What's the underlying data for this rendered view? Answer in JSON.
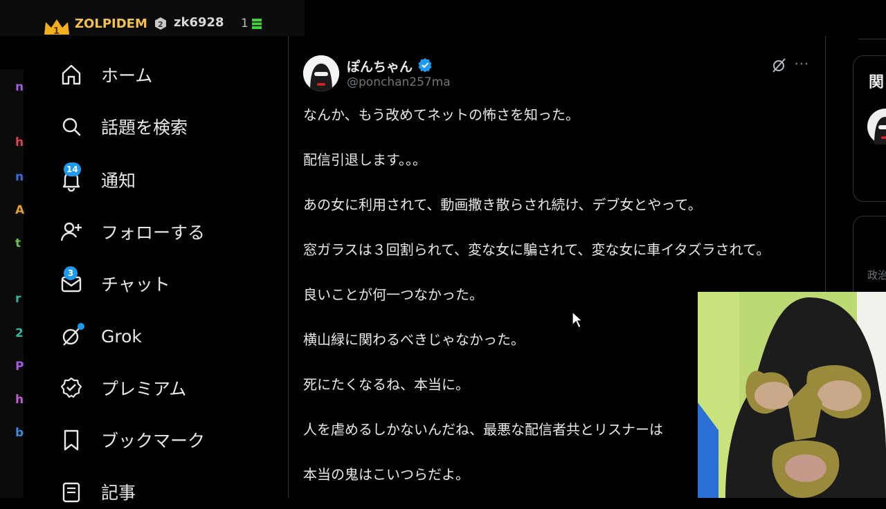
{
  "overlay": {
    "rank": "1",
    "streamer_name": "ZOLPIDEM",
    "user_badge": "2",
    "user_name": "zk6928",
    "count": "1"
  },
  "sidebar": {
    "items": [
      {
        "label": "ホーム",
        "icon": "home-icon"
      },
      {
        "label": "話題を検索",
        "icon": "search-icon"
      },
      {
        "label": "通知",
        "icon": "bell-icon",
        "badge": "14"
      },
      {
        "label": "フォローする",
        "icon": "follow-icon"
      },
      {
        "label": "チャット",
        "icon": "mail-icon",
        "badge": "3"
      },
      {
        "label": "Grok",
        "icon": "grok-icon"
      },
      {
        "label": "プレミアム",
        "icon": "premium-icon"
      },
      {
        "label": "ブックマーク",
        "icon": "bookmark-icon"
      },
      {
        "label": "記事",
        "icon": "article-icon"
      }
    ]
  },
  "post": {
    "display_name": "ぽんちゃん",
    "handle": "@ponchan257ma",
    "paragraphs": [
      "なんか、もう改めてネットの怖さを知った。",
      "配信引退します。。。",
      "あの女に利用されて、動画撒き散らされ続け、デブ女とやって。",
      "窓ガラスは３回割られて、変な女に騙されて、変な女に車イタズラされて。",
      "良いことが何一つなかった。",
      "横山緑に関わるべきじゃなかった。",
      "死にたくなるね、本当に。",
      "人を虐めるしかないんだね、最悪な配信者共とリスナーは",
      "本当の鬼はこいつらだよ。"
    ]
  },
  "right": {
    "card1_title": "関",
    "card2_quote": "「",
    "card2_small": "政治"
  },
  "colors": {
    "accent": "#1d9bf0",
    "text": "#e7e9ea",
    "muted": "#71767b",
    "border": "#2f3336",
    "overlay_gold": "#f2c14e"
  }
}
